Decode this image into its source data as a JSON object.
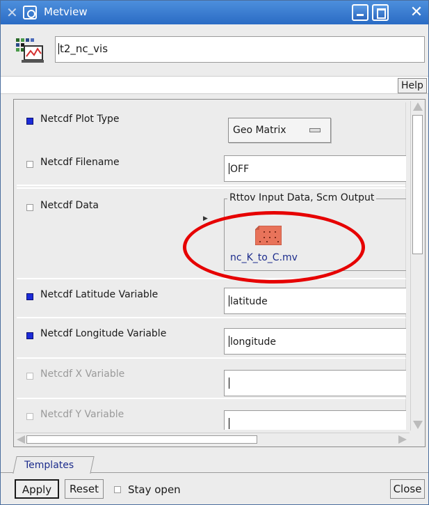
{
  "window": {
    "title": "Metview",
    "close_glyph": "✕",
    "menu_glyph": "✕"
  },
  "icon_name": {
    "value": "t2_nc_vis",
    "icon": "netcdf-visualiser-icon"
  },
  "toolbar": {
    "help_label": "Help"
  },
  "parameters": [
    {
      "label": "Netcdf Plot Type",
      "checked": true,
      "widget": "dropdown",
      "value": "Geo Matrix",
      "enabled": true
    },
    {
      "label": "Netcdf Filename",
      "checked": false,
      "widget": "text",
      "value": "OFF",
      "enabled": true
    },
    {
      "label": "Netcdf Data",
      "checked": false,
      "widget": "icon-drop",
      "value": "nc_K_to_C.mv",
      "frame_title": "Rttov Input Data, Scm Output",
      "enabled": true
    },
    {
      "label": "Netcdf Latitude Variable",
      "checked": true,
      "widget": "text",
      "value": "latitude",
      "enabled": true
    },
    {
      "label": "Netcdf Longitude Variable",
      "checked": true,
      "widget": "text",
      "value": "longitude",
      "enabled": true
    },
    {
      "label": "Netcdf X Variable",
      "checked": false,
      "widget": "text",
      "value": "",
      "enabled": false
    },
    {
      "label": "Netcdf Y Variable",
      "checked": false,
      "widget": "text",
      "value": "",
      "enabled": false
    }
  ],
  "tabs": [
    {
      "label": "Templates"
    }
  ],
  "buttons": {
    "apply": "Apply",
    "reset": "Reset",
    "stay_open": "Stay open",
    "close": "Close"
  },
  "colors": {
    "title_bar": "#2a6bc4",
    "checked": "#1c2bd8",
    "link_text": "#1c2c8c",
    "annotation": "#e60000"
  }
}
